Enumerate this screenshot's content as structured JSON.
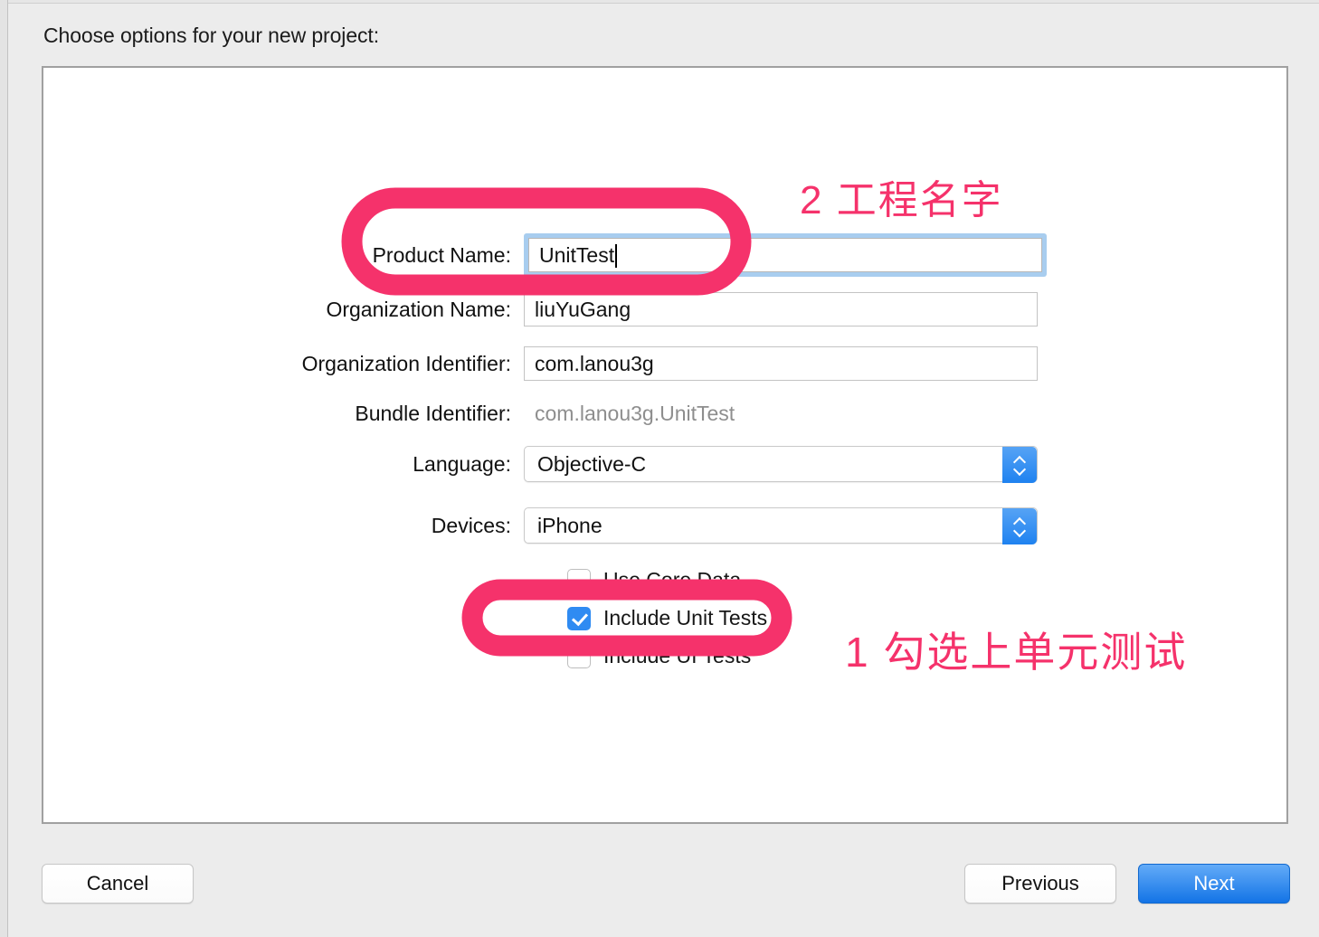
{
  "dialog": {
    "title": "Choose options for your new project:"
  },
  "form": {
    "rows": [
      {
        "label": "Product Name:",
        "value": "UnitTest",
        "type": "text-focused"
      },
      {
        "label": "Organization Name:",
        "value": "liuYuGang",
        "type": "text"
      },
      {
        "label": "Organization Identifier:",
        "value": "com.lanou3g",
        "type": "text"
      },
      {
        "label": "Bundle Identifier:",
        "value": "com.lanou3g.UnitTest",
        "type": "static"
      },
      {
        "label": "Language:",
        "value": "Objective-C",
        "type": "popup"
      },
      {
        "label": "Devices:",
        "value": "iPhone",
        "type": "popup"
      }
    ],
    "checkboxes": [
      {
        "label": "Use Core Data",
        "checked": false
      },
      {
        "label": "Include Unit Tests",
        "checked": true
      },
      {
        "label": "Include UI Tests",
        "checked": false
      }
    ]
  },
  "annotations": [
    {
      "text": "2 工程名字",
      "color": "#f5326b"
    },
    {
      "text": "1 勾选上单元测试",
      "color": "#f5326b"
    }
  ],
  "footer": {
    "cancel_label": "Cancel",
    "previous_label": "Previous",
    "next_label": "Next"
  },
  "colors": {
    "accent_blue": "#2f8bf2",
    "annotation_pink": "#f5326b",
    "focus_ring": "#a8cdef",
    "dialog_bg": "#ececec"
  }
}
